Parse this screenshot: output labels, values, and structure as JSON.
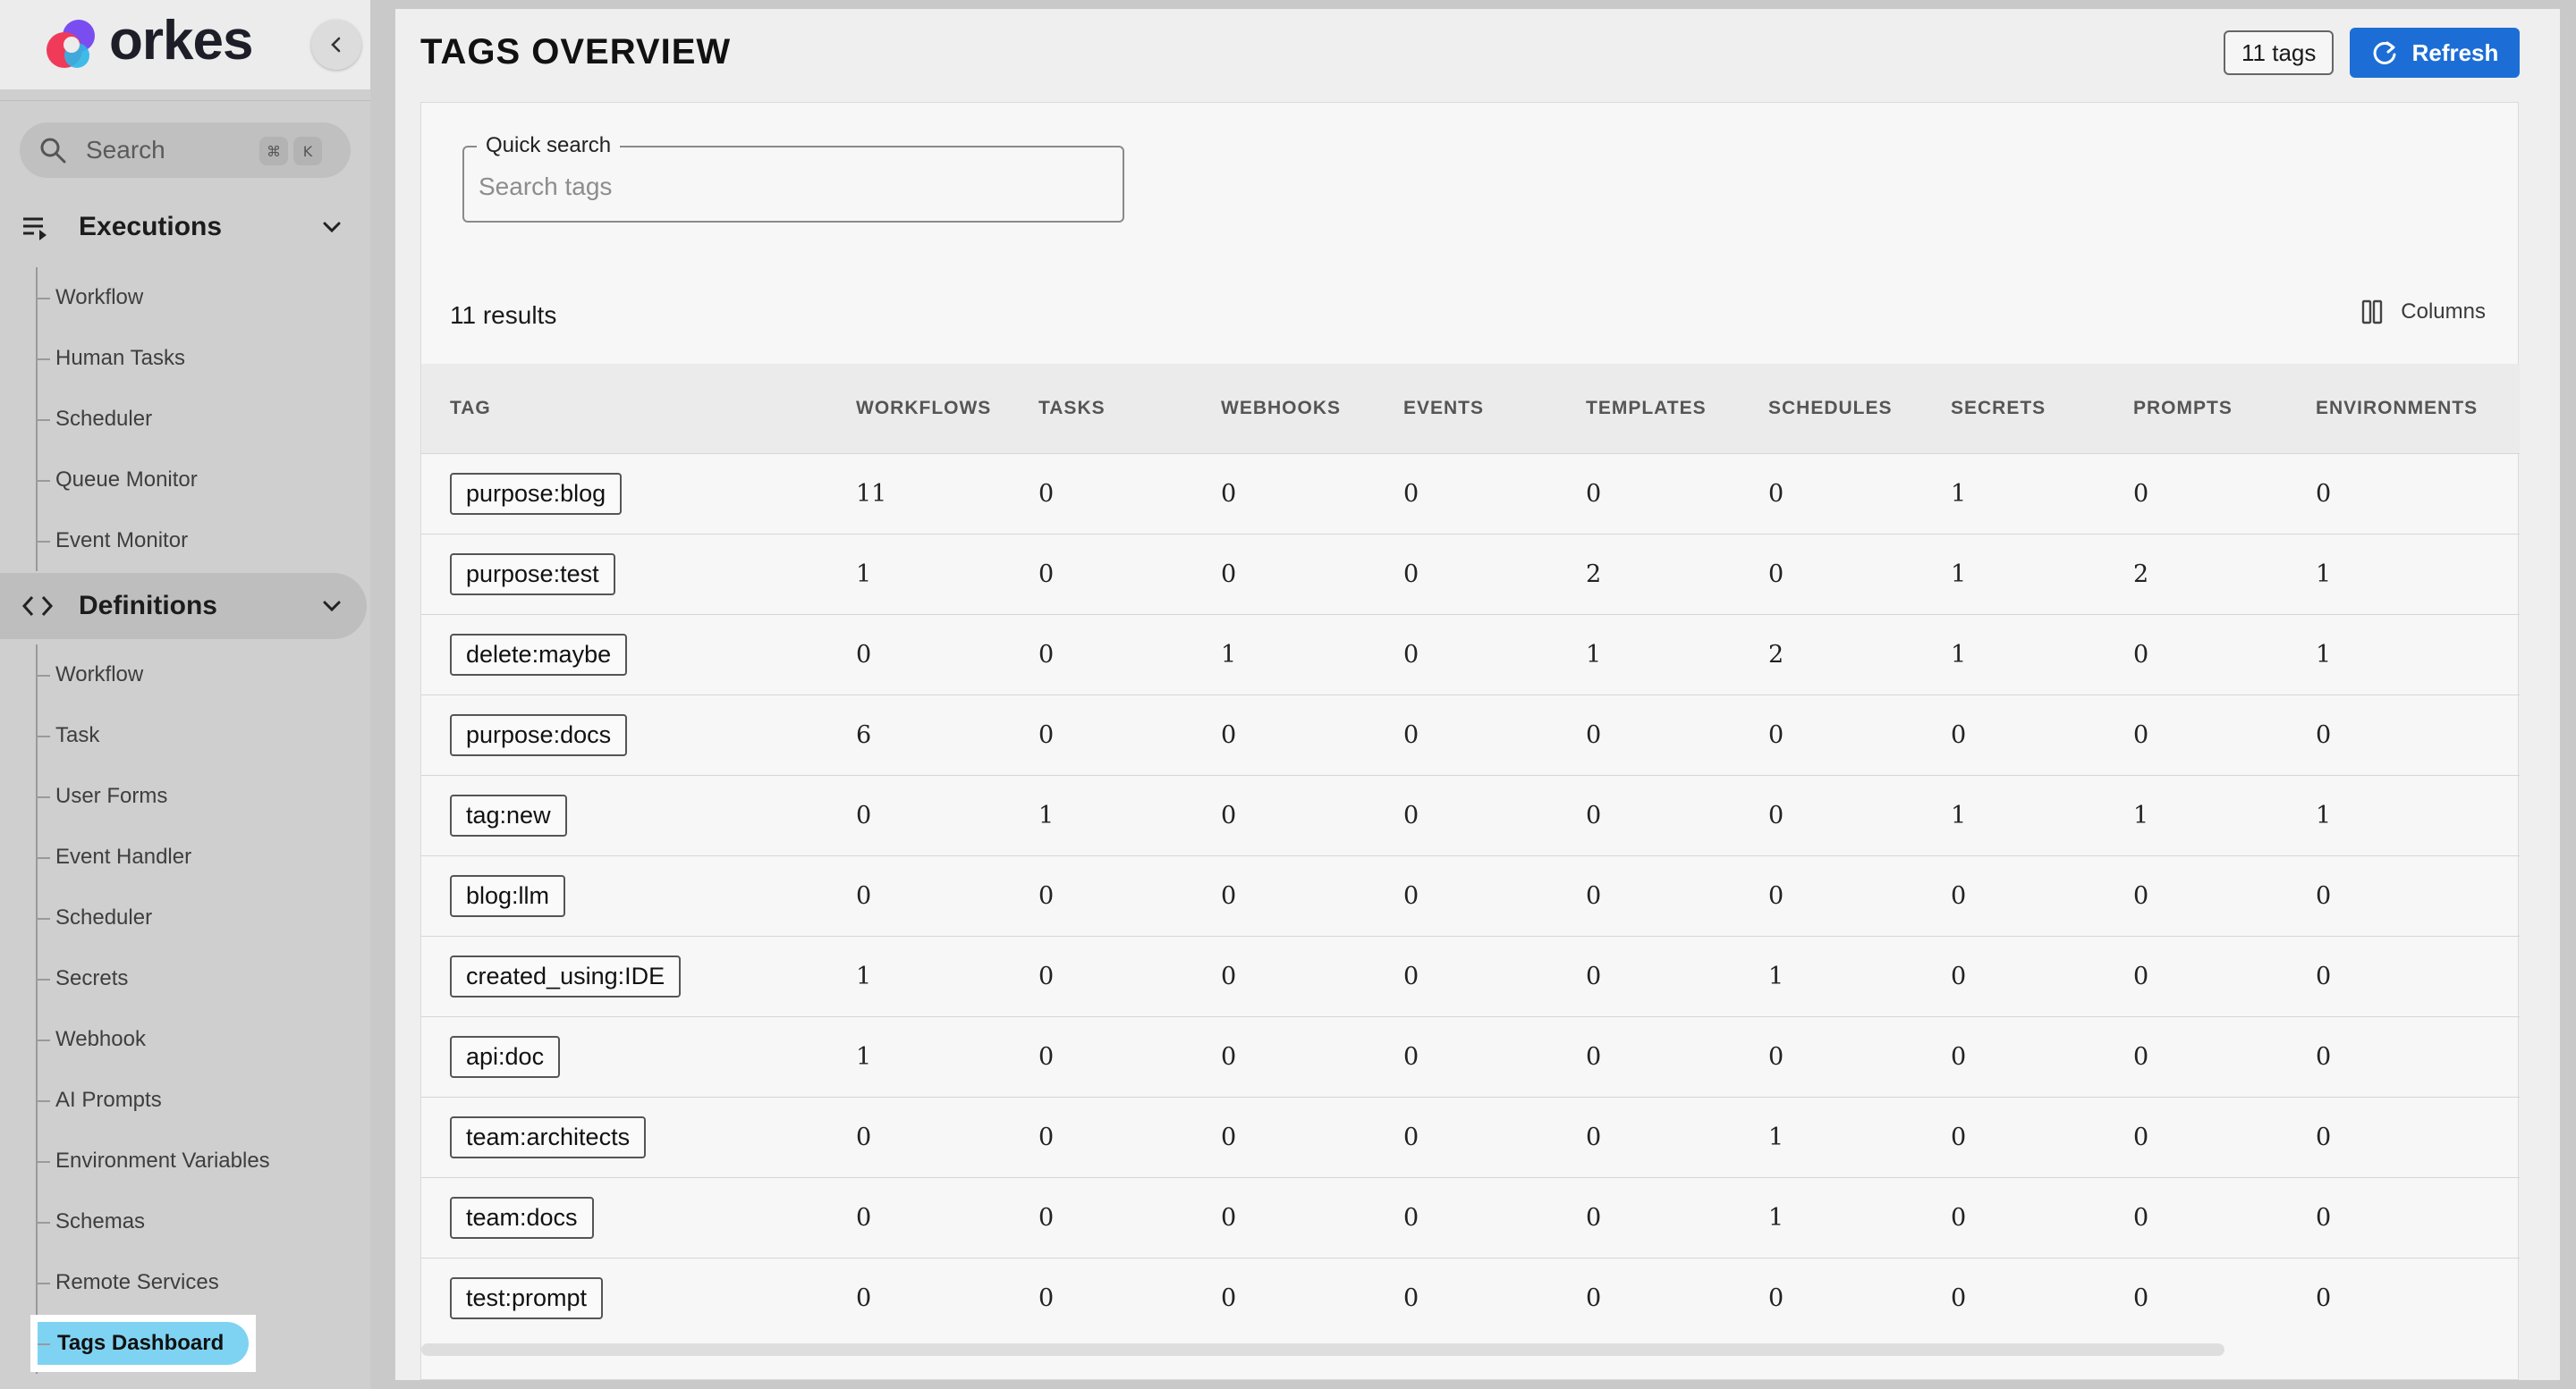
{
  "brand": {
    "name": "orkes"
  },
  "sidebar": {
    "search": {
      "label": "Search",
      "shortcut_keys": [
        "⌘",
        "K"
      ]
    },
    "executions": {
      "title": "Executions",
      "items": [
        "Workflow",
        "Human Tasks",
        "Scheduler",
        "Queue Monitor",
        "Event Monitor"
      ]
    },
    "definitions": {
      "title": "Definitions",
      "items": [
        "Workflow",
        "Task",
        "User Forms",
        "Event Handler",
        "Scheduler",
        "Secrets",
        "Webhook",
        "AI Prompts",
        "Environment Variables",
        "Schemas",
        "Remote Services",
        "Tags Dashboard"
      ],
      "selected": "Tags Dashboard"
    }
  },
  "header": {
    "title": "TAGS OVERVIEW",
    "tag_count": "11 tags",
    "refresh_label": "Refresh"
  },
  "search": {
    "legend": "Quick search",
    "placeholder": "Search tags"
  },
  "results_label": "11 results",
  "columns_label": "Columns",
  "table": {
    "columns": [
      "TAG",
      "WORKFLOWS",
      "TASKS",
      "WEBHOOKS",
      "EVENTS",
      "TEMPLATES",
      "SCHEDULES",
      "SECRETS",
      "PROMPTS",
      "ENVIRONMENTS"
    ],
    "rows": [
      [
        "purpose:blog",
        "11",
        "0",
        "0",
        "0",
        "0",
        "0",
        "1",
        "0",
        "0"
      ],
      [
        "purpose:test",
        "1",
        "0",
        "0",
        "0",
        "2",
        "0",
        "1",
        "2",
        "1"
      ],
      [
        "delete:maybe",
        "0",
        "0",
        "1",
        "0",
        "1",
        "2",
        "1",
        "0",
        "1"
      ],
      [
        "purpose:docs",
        "6",
        "0",
        "0",
        "0",
        "0",
        "0",
        "0",
        "0",
        "0"
      ],
      [
        "tag:new",
        "0",
        "1",
        "0",
        "0",
        "0",
        "0",
        "1",
        "1",
        "1"
      ],
      [
        "blog:llm",
        "0",
        "0",
        "0",
        "0",
        "0",
        "0",
        "0",
        "0",
        "0"
      ],
      [
        "created_using:IDE",
        "1",
        "0",
        "0",
        "0",
        "0",
        "1",
        "0",
        "0",
        "0"
      ],
      [
        "api:doc",
        "1",
        "0",
        "0",
        "0",
        "0",
        "0",
        "0",
        "0",
        "0"
      ],
      [
        "team:architects",
        "0",
        "0",
        "0",
        "0",
        "0",
        "1",
        "0",
        "0",
        "0"
      ],
      [
        "team:docs",
        "0",
        "0",
        "0",
        "0",
        "0",
        "1",
        "0",
        "0",
        "0"
      ],
      [
        "test:prompt",
        "0",
        "0",
        "0",
        "0",
        "0",
        "0",
        "0",
        "0",
        "0"
      ]
    ]
  },
  "colors": {
    "accent": "#1c6ed6",
    "selected_nav": "#7fd3f2"
  }
}
